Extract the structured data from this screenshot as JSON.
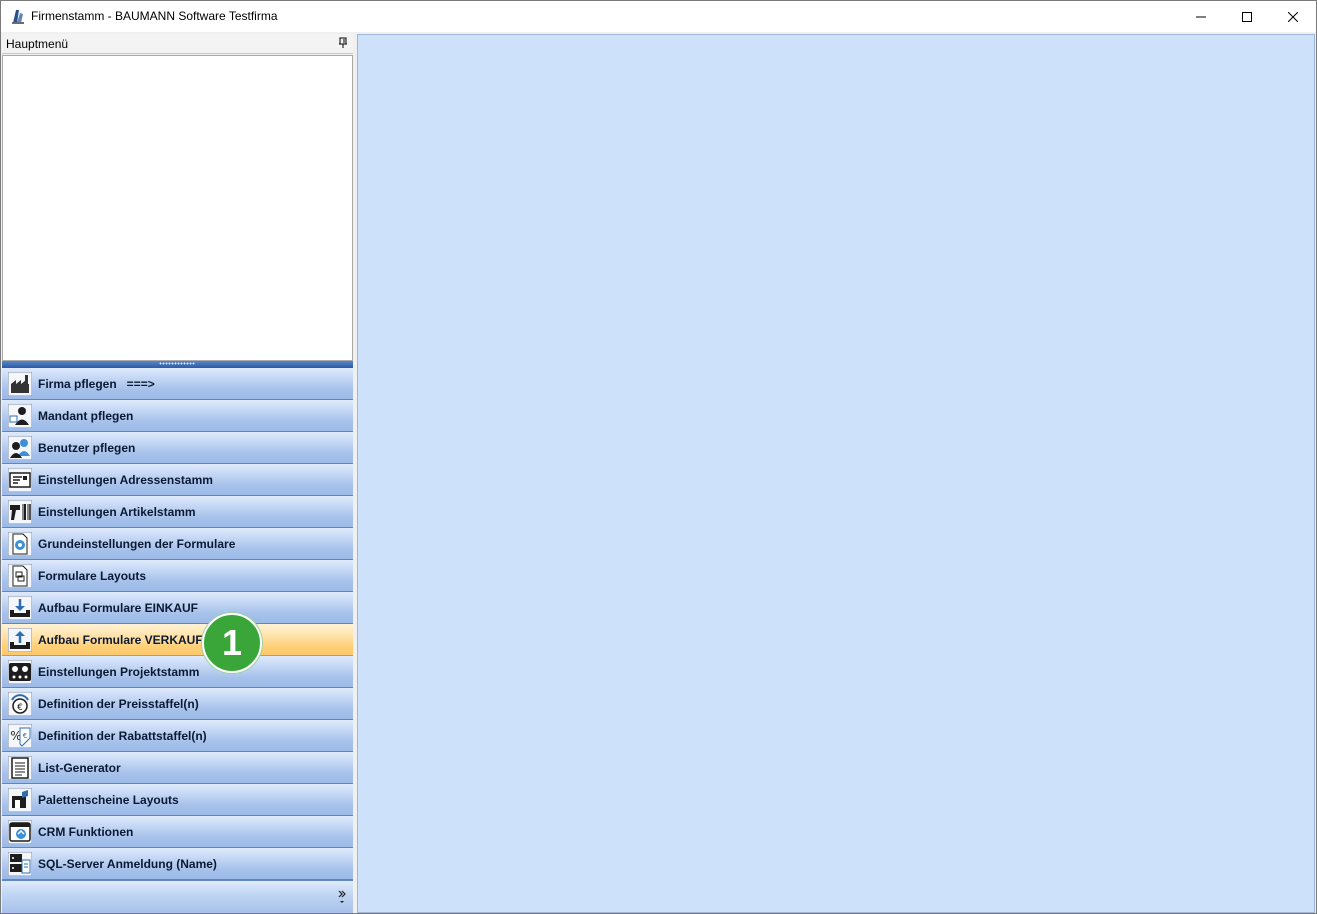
{
  "window": {
    "title": "Firmenstamm - BAUMANN Software Testfirma"
  },
  "panel": {
    "header": "Hauptmenü"
  },
  "nav": {
    "items": [
      {
        "label": "Firma pflegen   ===>",
        "icon": "factory-icon"
      },
      {
        "label": "Mandant pflegen",
        "icon": "client-user-icon"
      },
      {
        "label": "Benutzer pflegen",
        "icon": "users-icon"
      },
      {
        "label": "Einstellungen Adressenstamm",
        "icon": "address-card-icon"
      },
      {
        "label": "Einstellungen Artikelstamm",
        "icon": "barcode-scanner-icon"
      },
      {
        "label": "Grundeinstellungen der Formulare",
        "icon": "form-settings-icon"
      },
      {
        "label": "Formulare Layouts",
        "icon": "form-layout-icon"
      },
      {
        "label": "Aufbau Formulare EINKAUF",
        "icon": "download-tray-icon"
      },
      {
        "label": "Aufbau Formulare VERKAUF",
        "icon": "upload-tray-icon",
        "selected": true
      },
      {
        "label": "Einstellungen Projektstamm",
        "icon": "project-control-icon"
      },
      {
        "label": "Definition der Preisstaffel(n)",
        "icon": "price-scale-icon"
      },
      {
        "label": "Definition der Rabattstaffel(n)",
        "icon": "discount-icon"
      },
      {
        "label": "List-Generator",
        "icon": "list-icon"
      },
      {
        "label": "Palettenscheine Layouts",
        "icon": "pallet-icon"
      },
      {
        "label": "CRM Funktionen",
        "icon": "crm-icon"
      },
      {
        "label": "SQL-Server Anmeldung (Name)",
        "icon": "server-icon"
      }
    ]
  },
  "annotation": {
    "badge": "1"
  },
  "colors": {
    "nav_gradient_top": "#dfeafc",
    "nav_gradient_bottom": "#9cbbe8",
    "selected_gradient_top": "#fff3d6",
    "selected_gradient_bottom": "#fcc86a",
    "content_bg": "#cde1fb",
    "badge": "#3aa63a"
  }
}
